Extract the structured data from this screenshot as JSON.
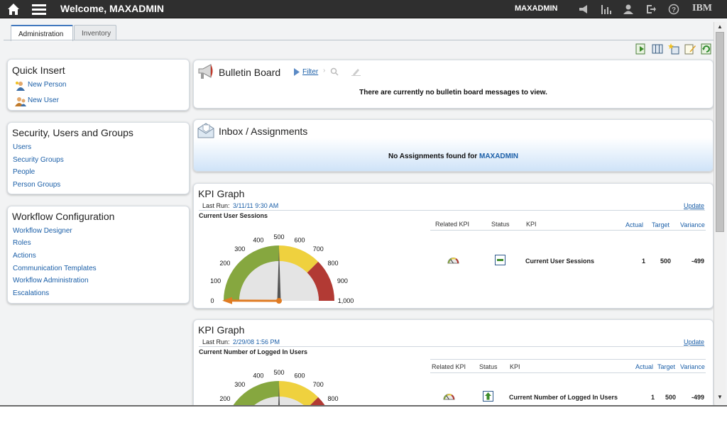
{
  "header": {
    "welcome": "Welcome, MAXADMIN",
    "user": "MAXADMIN",
    "brand": "IBM",
    "icons": [
      "home-icon",
      "menu-icon",
      "announcement-icon",
      "reports-icon",
      "profile-icon",
      "sign-out-icon",
      "help-icon"
    ]
  },
  "tabs": [
    {
      "label": "Administration",
      "active": true
    },
    {
      "label": "Inventory",
      "active": false
    }
  ],
  "toolbar_icons": [
    "add-portlet-icon",
    "layout-icon",
    "add-start-center-icon",
    "edit-icon",
    "refresh-icon"
  ],
  "quick_insert": {
    "title": "Quick Insert",
    "items": [
      "New Person",
      "New User"
    ]
  },
  "security": {
    "title": "Security, Users and Groups",
    "items": [
      "Users",
      "Security Groups",
      "People",
      "Person Groups"
    ]
  },
  "workflow": {
    "title": "Workflow Configuration",
    "items": [
      "Workflow Designer",
      "Roles",
      "Actions",
      "Communication Templates",
      "Workflow Administration",
      "Escalations"
    ]
  },
  "bulletin": {
    "title": "Bulletin Board",
    "filter": "Filter",
    "message": "There are currently no bulletin board messages to view."
  },
  "inbox": {
    "title": "Inbox / Assignments",
    "message": "No Assignments found for ",
    "user": "MAXADMIN"
  },
  "kpi_graphs": [
    {
      "title": "KPI Graph",
      "last_run_label": "Last Run:",
      "last_run": "3/11/11 9:30 AM",
      "update": "Update",
      "kpi_name": "Current User Sessions",
      "columns": [
        "Related KPI",
        "Status",
        "KPI",
        "Actual",
        "Target",
        "Variance"
      ],
      "row": {
        "kpi": "Current User Sessions",
        "actual": "1",
        "target": "500",
        "variance": "-499"
      },
      "status": "minus-status-icon",
      "gauge": {
        "min": 0,
        "max": 1000,
        "target": 500,
        "value": 1,
        "ticks": [
          "0",
          "100",
          "200",
          "300",
          "400",
          "500",
          "600",
          "700",
          "800",
          "900",
          "1,000"
        ],
        "bands": [
          {
            "to": 500,
            "color": "#86a73f"
          },
          {
            "to": 750,
            "color": "#efd13e"
          },
          {
            "to": 1000,
            "color": "#b23a34"
          }
        ]
      }
    },
    {
      "title": "KPI Graph",
      "last_run_label": "Last Run:",
      "last_run": "2/29/08 1:56 PM",
      "update": "Update",
      "kpi_name": "Current Number of Logged In Users",
      "columns": [
        "Related KPI",
        "Status",
        "KPI",
        "Actual",
        "Target",
        "Variance"
      ],
      "row": {
        "kpi": "Current Number of Logged In Users",
        "actual": "1",
        "target": "500",
        "variance": "-499"
      },
      "status": "up-arrow-status-icon",
      "gauge": {
        "ticks": [
          "200",
          "300",
          "400",
          "500",
          "600",
          "700",
          "800"
        ]
      }
    }
  ]
}
